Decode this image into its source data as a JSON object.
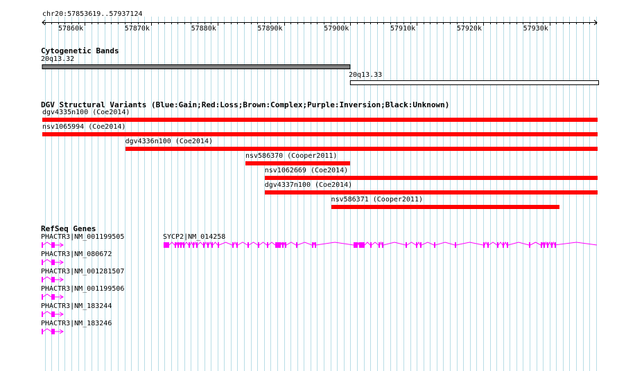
{
  "location": "chr20:57853619..57937124",
  "view": {
    "start": 57853619,
    "end": 57937124
  },
  "ruler": {
    "ticks": [
      "57860k",
      "57870k",
      "57880k",
      "57890k",
      "57900k",
      "57910k",
      "57920k",
      "57930k"
    ],
    "tick_values": [
      57860000,
      57870000,
      57880000,
      57890000,
      57900000,
      57910000,
      57920000,
      57930000
    ]
  },
  "colors": {
    "grid": "#b8dde6",
    "band_dark": "#808080",
    "variant_loss": "#ff0000",
    "gene": "#ff00ff"
  },
  "cyto": {
    "title": "Cytogenetic Bands",
    "bands": [
      {
        "name": "20q13.32",
        "start": 57853619,
        "end": 57899950,
        "style": "dark"
      },
      {
        "name": "20q13.33",
        "start": 57899950,
        "end": 57937124,
        "style": "outline"
      }
    ]
  },
  "dgv": {
    "title": "DGV Structural Variants (Blue:Gain;Red:Loss;Brown:Complex;Purple:Inversion;Black:Unknown)",
    "variants": [
      {
        "label": "dgv4335n100 (Coe2014)",
        "start": 57853619,
        "end": 57937124
      },
      {
        "label": "nsv1065994 (Coe2014)",
        "start": 57853619,
        "end": 57937124
      },
      {
        "label": "dgv4336n100 (Coe2014)",
        "start": 57866100,
        "end": 57937124
      },
      {
        "label": "nsv586370 (Cooper2011)",
        "start": 57884200,
        "end": 57899900
      },
      {
        "label": "nsv1062669 (Coe2014)",
        "start": 57887100,
        "end": 57937124
      },
      {
        "label": "dgv4337n100 (Coe2014)",
        "start": 57887100,
        "end": 57937124
      },
      {
        "label": "nsv586371 (Cooper2011)",
        "start": 57897100,
        "end": 57931400
      }
    ]
  },
  "refseq": {
    "title": "RefSeq Genes",
    "genes": [
      {
        "label": "PHACTR3|NM_001199505"
      },
      {
        "label": "PHACTR3|NM_080672"
      },
      {
        "label": "PHACTR3|NM_001281507"
      },
      {
        "label": "PHACTR3|NM_001199506"
      },
      {
        "label": "PHACTR3|NM_183244"
      },
      {
        "label": "PHACTR3|NM_183246"
      }
    ],
    "sycp2": {
      "label": "SYCP2|NM_014258",
      "start": 57872700,
      "end": 57937124
    }
  }
}
